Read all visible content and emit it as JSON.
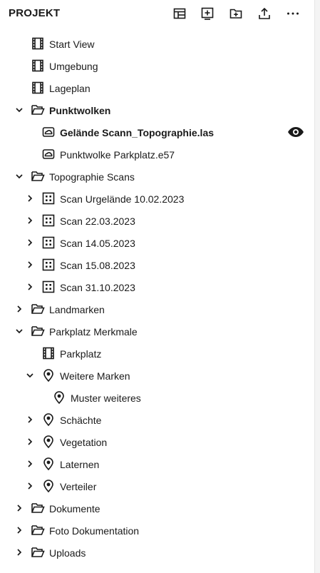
{
  "header": {
    "title": "PROJEKT",
    "icons": [
      "layout-icon",
      "add-view-icon",
      "add-folder-icon",
      "upload-icon",
      "more-icon"
    ]
  },
  "tree": {
    "items": [
      {
        "label": "Start View",
        "icon": "view-icon"
      },
      {
        "label": "Umgebung",
        "icon": "view-icon"
      },
      {
        "label": "Lageplan",
        "icon": "view-icon"
      },
      {
        "label": "Punktwolken",
        "icon": "folder-open-icon",
        "expanded": true,
        "bold": true
      },
      {
        "label": "Gelände Scann_Topographie.las",
        "icon": "pointcloud-icon",
        "bold": true,
        "visible_icon": "eye-icon"
      },
      {
        "label": "Punktwolke Parkplatz.e57",
        "icon": "pointcloud-icon"
      },
      {
        "label": "Topographie Scans",
        "icon": "folder-open-icon",
        "expanded": true
      },
      {
        "label": " Scan Urgelände 10.02.2023",
        "icon": "scan-icon",
        "expanded": false
      },
      {
        "label": "Scan 22.03.2023",
        "icon": "scan-icon",
        "expanded": false
      },
      {
        "label": "Scan 14.05.2023",
        "icon": "scan-icon",
        "expanded": false
      },
      {
        "label": "Scan 15.08.2023",
        "icon": "scan-icon",
        "expanded": false
      },
      {
        "label": "Scan 31.10.2023",
        "icon": "scan-icon",
        "expanded": false
      },
      {
        "label": "Landmarken",
        "icon": "folder-icon",
        "expanded": false
      },
      {
        "label": "Parkplatz Merkmale",
        "icon": "folder-open-icon",
        "expanded": true
      },
      {
        "label": "Parkplatz",
        "icon": "view-icon"
      },
      {
        "label": "Weitere Marken",
        "icon": "pin-icon",
        "expanded": true
      },
      {
        "label": "Muster weiteres",
        "icon": "pin-icon"
      },
      {
        "label": "Schächte",
        "icon": "pin-icon",
        "expanded": false
      },
      {
        "label": "Vegetation",
        "icon": "pin-icon",
        "expanded": false
      },
      {
        "label": "Laternen",
        "icon": "pin-icon",
        "expanded": false
      },
      {
        "label": "Verteiler",
        "icon": "pin-icon",
        "expanded": false
      },
      {
        "label": "Dokumente",
        "icon": "folder-icon",
        "expanded": false
      },
      {
        "label": "Foto Dokumentation",
        "icon": "folder-icon",
        "expanded": false
      },
      {
        "label": "Uploads",
        "icon": "folder-icon",
        "expanded": false
      }
    ]
  },
  "colors": {
    "text": "#1a1a1a",
    "background": "#ffffff"
  }
}
